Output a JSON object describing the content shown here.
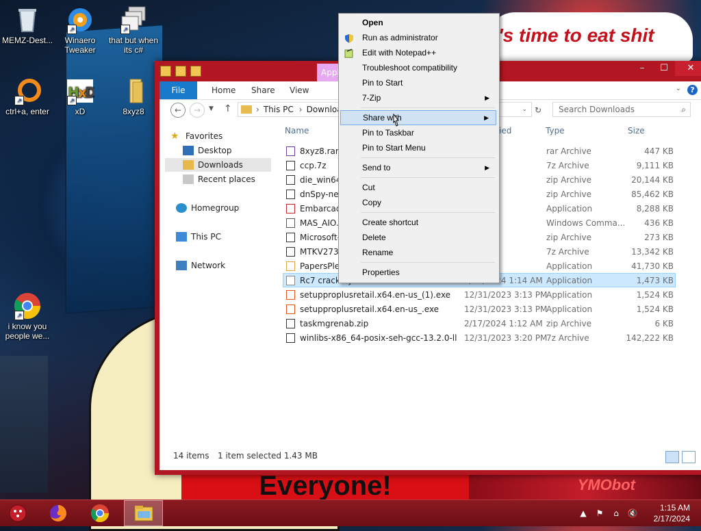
{
  "wallpaper": {
    "speech_text": "'s time to eat shit",
    "sign_text": "Everyone!",
    "bottom_right_text": "YMObot"
  },
  "desktop_icons": [
    {
      "label": "MEMZ-Dest..."
    },
    {
      "label": "Winaero Tweaker"
    },
    {
      "label": "that but when its c#"
    },
    {
      "label": "ctrl+a, enter"
    },
    {
      "label": "xD"
    },
    {
      "label": "8xyz8"
    },
    {
      "label": "i know you people we..."
    }
  ],
  "window": {
    "contextual_tab": "Appli",
    "ribbon": {
      "file": "File",
      "home": "Home",
      "share": "Share",
      "view": "View",
      "partial": "M"
    },
    "address": {
      "this_pc": "This PC",
      "downloads": "Download",
      "separator": "›"
    },
    "search_placeholder": "Search Downloads",
    "nav": {
      "favorites": "Favorites",
      "desktop": "Desktop",
      "downloads": "Downloads",
      "recent": "Recent places",
      "homegroup": "Homegroup",
      "this_pc": "This PC",
      "network": "Network"
    },
    "columns": {
      "name": "Name",
      "date_partial": "ied",
      "type": "Type",
      "size": "Size"
    },
    "files": [
      {
        "name": "8xyz8.rar",
        "date": ":08 AM",
        "type": "rar Archive",
        "size": "447 KB",
        "color": "#6a3d9a"
      },
      {
        "name": "ccp.7z",
        "date": "3:28 PM",
        "type": "7z Archive",
        "size": "9,111 KB",
        "color": "#333333"
      },
      {
        "name": "die_win64_p",
        "date": "3:24 PM",
        "type": "zip Archive",
        "size": "20,144 KB",
        "color": "#333333"
      },
      {
        "name": "dnSpy-net-w",
        "date": "3:24 PM",
        "type": "zip Archive",
        "size": "85,462 KB",
        "color": "#333333"
      },
      {
        "name": "Embarcader",
        "date": "3:20 PM",
        "type": "Application",
        "size": "8,288 KB",
        "color": "#c4262e"
      },
      {
        "name": "MAS_AIO.cm",
        "date": "3:17 AM",
        "type": "Windows Comma...",
        "size": "436 KB",
        "color": "#555555"
      },
      {
        "name": "Microsoft-A",
        "date": "2:59 PM",
        "type": "zip Archive",
        "size": "273 KB",
        "color": "#333333"
      },
      {
        "name": "MTKV273.7z",
        "date": "3:05 PM",
        "type": "7z Archive",
        "size": "13,342 KB",
        "color": "#333333"
      },
      {
        "name": "PapersPlease",
        "date": "3:32 PM",
        "type": "Application",
        "size": "41,730 KB",
        "color": "#d9a441"
      },
      {
        "name": "Rc7 crack by rufficn.exe",
        "date": "2/17/2024 1:14 AM",
        "type": "Application",
        "size": "1,473 KB",
        "color": "#888888",
        "selected": true
      },
      {
        "name": "setupproplusretail.x64.en-us_(1).exe",
        "date": "12/31/2023 3:13 PM",
        "type": "Application",
        "size": "1,524 KB",
        "color": "#e8531f"
      },
      {
        "name": "setupproplusretail.x64.en-us_.exe",
        "date": "12/31/2023 3:13 PM",
        "type": "Application",
        "size": "1,524 KB",
        "color": "#e8531f"
      },
      {
        "name": "taskmgrenab.zip",
        "date": "2/17/2024 1:12 AM",
        "type": "zip Archive",
        "size": "6 KB",
        "color": "#333333"
      },
      {
        "name": "winlibs-x86_64-posix-seh-gcc-13.2.0-llv...",
        "date": "12/31/2023 3:20 PM",
        "type": "7z Archive",
        "size": "142,222 KB",
        "color": "#333333"
      }
    ],
    "status": {
      "count": "14 items",
      "selection": "1 item selected  1.43 MB"
    }
  },
  "context_menu": {
    "open": "Open",
    "run_admin": "Run as administrator",
    "notepad": "Edit with Notepad++",
    "troubleshoot": "Troubleshoot compatibility",
    "pin_start": "Pin to Start",
    "sevenzip": "7-Zip",
    "share_with": "Share with",
    "pin_taskbar": "Pin to Taskbar",
    "pin_start_menu": "Pin to Start Menu",
    "send_to": "Send to",
    "cut": "Cut",
    "copy": "Copy",
    "create_shortcut": "Create shortcut",
    "delete": "Delete",
    "rename": "Rename",
    "properties": "Properties"
  },
  "taskbar": {
    "time": "1:15 AM",
    "date": "2/17/2024"
  },
  "colors": {
    "window_border": "#b11622",
    "file_tab": "#1979ca",
    "selection": "#cce8ff",
    "menu_highlight": "#d1e2f2",
    "taskbar": "#7a141a"
  }
}
